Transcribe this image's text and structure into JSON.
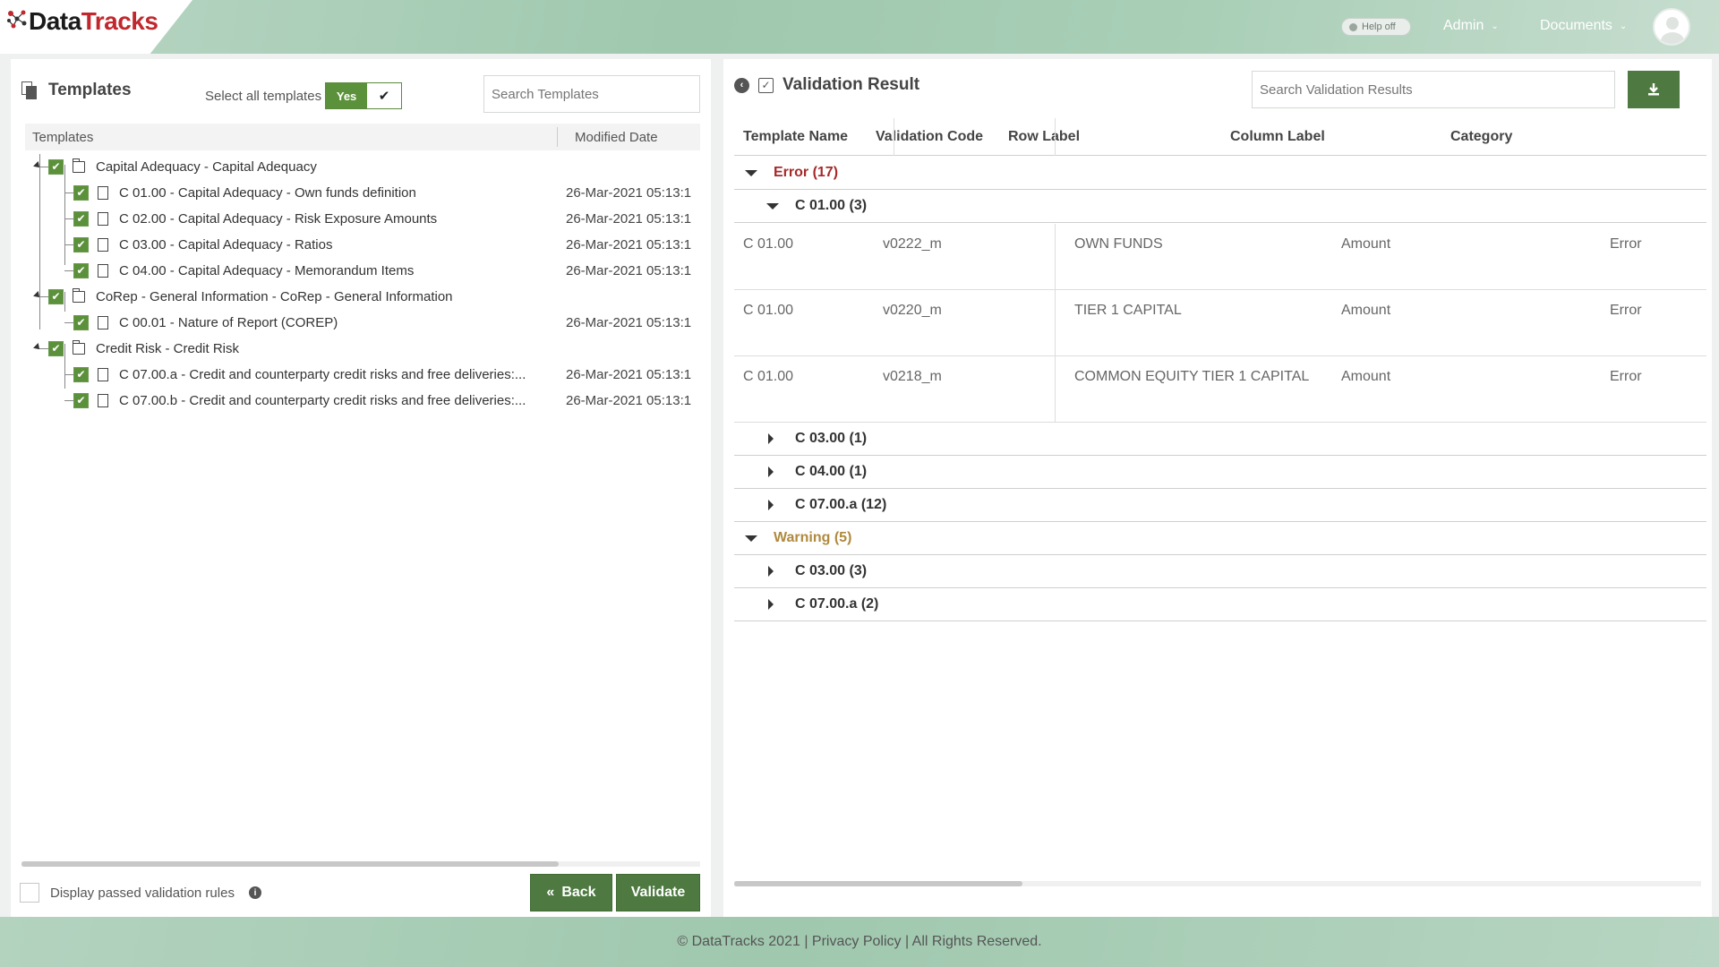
{
  "header": {
    "logo_data": "Data",
    "logo_tracks": "Tracks",
    "help_toggle": "Help off",
    "admin_menu": "Admin",
    "documents_menu": "Documents"
  },
  "templates_panel": {
    "title": "Templates",
    "select_all_label": "Select all templates",
    "select_all_value": "Yes",
    "search_placeholder": "Search Templates",
    "columns": {
      "name": "Templates",
      "date": "Modified Date"
    },
    "rows": [
      {
        "label": "Capital Adequacy - Capital Adequacy",
        "date": "",
        "type": "folder",
        "level": 0
      },
      {
        "label": "C 01.00 - Capital Adequacy - Own funds definition",
        "date": "26-Mar-2021 05:13:1",
        "type": "file",
        "level": 1
      },
      {
        "label": "C 02.00 - Capital Adequacy - Risk Exposure Amounts",
        "date": "26-Mar-2021 05:13:1",
        "type": "file",
        "level": 1
      },
      {
        "label": "C 03.00 - Capital Adequacy - Ratios",
        "date": "26-Mar-2021 05:13:1",
        "type": "file",
        "level": 1
      },
      {
        "label": "C 04.00 - Capital Adequacy - Memorandum Items",
        "date": "26-Mar-2021 05:13:1",
        "type": "file",
        "level": 1
      },
      {
        "label": "CoRep - General Information - CoRep - General Information",
        "date": "",
        "type": "folder",
        "level": 0
      },
      {
        "label": "C 00.01 - Nature of Report (COREP)",
        "date": "26-Mar-2021 05:13:1",
        "type": "file",
        "level": 1
      },
      {
        "label": "Credit Risk - Credit Risk",
        "date": "",
        "type": "folder",
        "level": 0
      },
      {
        "label": "C 07.00.a - Credit and counterparty credit risks and free deliveries:...",
        "date": "26-Mar-2021 05:13:1",
        "type": "file",
        "level": 1
      },
      {
        "label": "C 07.00.b - Credit and counterparty credit risks and free deliveries:...",
        "date": "26-Mar-2021 05:13:1",
        "type": "file",
        "level": 1
      }
    ],
    "display_passed_label": "Display passed validation rules",
    "back_label": "Back",
    "validate_label": "Validate"
  },
  "validation_panel": {
    "title": "Validation Result",
    "search_placeholder": "Search Validation Results",
    "columns": [
      "Template Name",
      "Validation Code",
      "Row Label",
      "Column Label",
      "Category"
    ],
    "groups": {
      "error": "Error (17)",
      "error_c0100": "C 01.00 (3)",
      "error_c0300": "C 03.00 (1)",
      "error_c0400": "C 04.00 (1)",
      "error_c0700a": "C 07.00.a (12)",
      "warning": "Warning (5)",
      "warning_c0300": "C 03.00 (3)",
      "warning_c0700a": "C 07.00.a (2)"
    },
    "rows": [
      {
        "template": "C 01.00",
        "code": "v0222_m",
        "row_label": "OWN FUNDS",
        "column_label": "Amount",
        "category": "Error"
      },
      {
        "template": "C 01.00",
        "code": "v0220_m",
        "row_label": "TIER 1 CAPITAL",
        "column_label": "Amount",
        "category": "Error"
      },
      {
        "template": "C 01.00",
        "code": "v0218_m",
        "row_label": "COMMON EQUITY TIER 1 CAPITAL",
        "column_label": "Amount",
        "category": "Error"
      }
    ],
    "error_color": "#a52a2a",
    "warning_color": "#b08a3e"
  },
  "footer": {
    "copyright": "© DataTracks 2021 | ",
    "privacy": "Privacy Policy",
    "rights": " | All Rights Reserved."
  },
  "colors": {
    "accent": "#5c913b",
    "button": "#4e7a41"
  }
}
